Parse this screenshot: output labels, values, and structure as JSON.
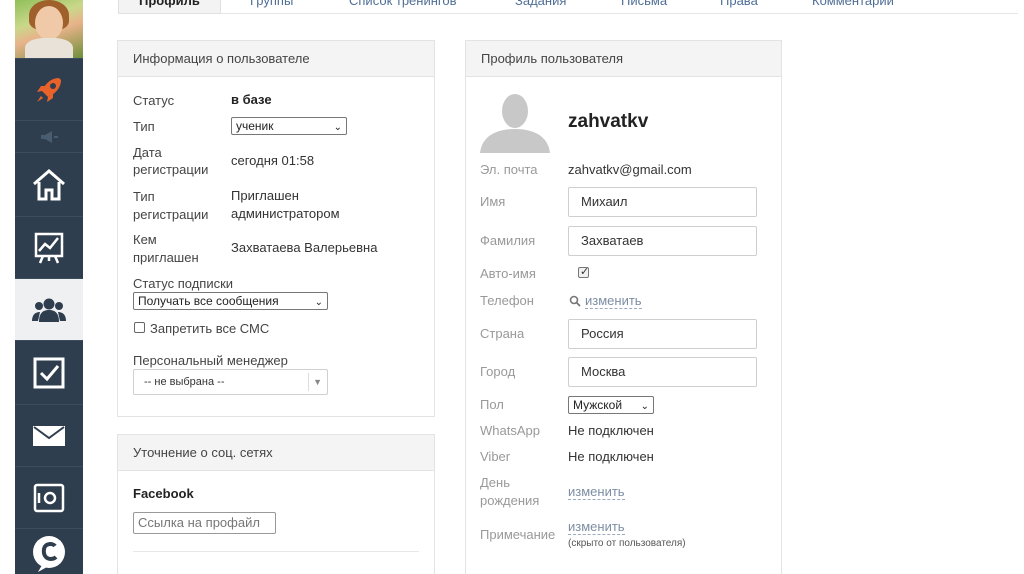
{
  "tabs": [
    "Профиль",
    "Группы",
    "Список тренингов",
    "Задания",
    "Письма",
    "Права",
    "Комментарии"
  ],
  "user_info": {
    "title": "Информация о пользователе",
    "status_label": "Статус",
    "status_value": "в базе",
    "type_label": "Тип",
    "type_value": "ученик",
    "reg_date_label_1": "Дата",
    "reg_date_label_2": "регистрации",
    "reg_date_value": "сегодня 01:58",
    "reg_type_label_1": "Тип",
    "reg_type_label_2": "регистрации",
    "reg_type_value_1": "Приглашен",
    "reg_type_value_2": "администратором",
    "invited_label_1": "Кем",
    "invited_label_2": "приглашен",
    "invited_value": "Захватаева Валерьевна",
    "subscription_label": "Статус подписки",
    "subscription_value": "Получать все сообщения",
    "sms_label": "Запретить все СМС",
    "manager_label": "Персональный менеджер",
    "manager_value": "-- не выбрана --"
  },
  "social": {
    "title": "Уточнение о соц. сетях",
    "facebook_label": "Facebook",
    "facebook_placeholder": "Ссылка на профайл"
  },
  "profile": {
    "title": "Профиль пользователя",
    "username": "zahvatkv",
    "email_label": "Эл. почта",
    "email_value": "zahvatkv@gmail.com",
    "name_label": "Имя",
    "name_value": "Михаил",
    "surname_label": "Фамилия",
    "surname_value": "Захватаев",
    "autoname_label": "Авто-имя",
    "autoname_checked": true,
    "phone_label": "Телефон",
    "phone_link": "изменить",
    "country_label": "Страна",
    "country_value": "Россия",
    "city_label": "Город",
    "city_value": "Москва",
    "gender_label": "Пол",
    "gender_value": "Мужской",
    "whatsapp_label": "WhatsApp",
    "whatsapp_value": "Не подключен",
    "viber_label": "Viber",
    "viber_value": "Не подключен",
    "birthday_label_1": "День",
    "birthday_label_2": "рождения",
    "birthday_link": "изменить",
    "note_label": "Примечание",
    "note_link": "изменить",
    "note_hint": "(скрыто от пользователя)"
  },
  "sidebar": {
    "items": [
      "rocket-icon",
      "megaphone-icon",
      "home-icon",
      "chart-icon",
      "users-icon",
      "checkbox-icon",
      "mail-icon",
      "settings-icon",
      "chat-icon"
    ],
    "active": "users-icon"
  },
  "colors": {
    "sidebar": "#2f3e4e",
    "accent": "#e8622a",
    "link": "#4f6e96"
  }
}
